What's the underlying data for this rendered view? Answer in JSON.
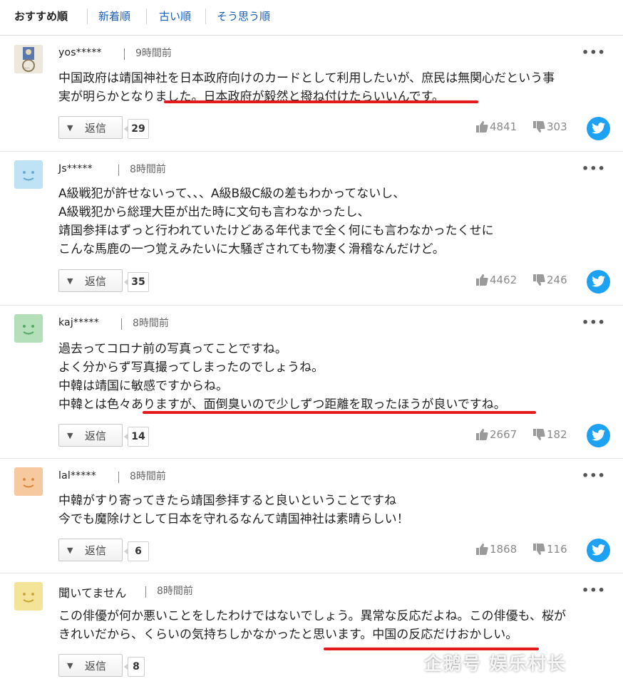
{
  "sort_tabs": [
    "おすすめ順",
    "新着順",
    "古い順",
    "そう思う順"
  ],
  "reply_label": "返信",
  "comments": [
    {
      "username": "yos*****",
      "time": "9時間前",
      "lines": [
        "中国政府は靖国神社を日本政府向けのカードとして利用したいが、庶民は無関心だという事",
        "実が明らかとなりました。日本政府が毅然と撥ね付けたらいいんです。"
      ],
      "reply_count": "29",
      "likes": "4841",
      "dislikes": "303"
    },
    {
      "username": "Js*****",
      "time": "8時間前",
      "lines": [
        "A級戦犯が許せないって、、、A級B級C級の差もわかってないし、",
        "A級戦犯から総理大臣が出た時に文句も言わなかったし、",
        "靖国参拝はずっと行われていたけどある年代まで全く何にも言わなかったくせに",
        "こんな馬鹿の一つ覚えみたいに大騒ぎされても物凄く滑稽なんだけど。"
      ],
      "reply_count": "35",
      "likes": "4462",
      "dislikes": "246"
    },
    {
      "username": "kaj*****",
      "time": "8時間前",
      "lines": [
        "過去ってコロナ前の写真ってことですね。",
        "よく分からず写真撮ってしまったのでしょうね。",
        "中韓は靖国に敏感ですからね。",
        "中韓とは色々ありますが、面倒臭いので少しずつ距離を取ったほうが良いですね。"
      ],
      "reply_count": "14",
      "likes": "2667",
      "dislikes": "182"
    },
    {
      "username": "lal*****",
      "time": "8時間前",
      "lines": [
        "中韓がすり寄ってきたら靖国参拝すると良いということですね",
        "今でも魔除けとして日本を守れるなんて靖国神社は素晴らしい！"
      ],
      "reply_count": "6",
      "likes": "1868",
      "dislikes": "116"
    },
    {
      "username": "聞いてません",
      "time": "8時間前",
      "lines": [
        "この俳優が何か悪いことをしたわけではないでしょう。異常な反応だよね。この俳優も、桜が",
        "きれいだから、くらいの気持ちしかなかったと思います。中国の反応だけおかしい。"
      ],
      "reply_count": "8"
    }
  ],
  "watermark": "企鹅号 娱乐村长",
  "colors": {
    "tab_link": "#1a5fb4",
    "underline": "#e3191b",
    "twitter": "#1da1f2",
    "avatar_blue": "#bde3f5",
    "avatar_green": "#b3dfb9",
    "avatar_orange": "#f6c99e",
    "avatar_yellow": "#f4e49a"
  },
  "icons": [
    "chevron-down-icon",
    "thumbs-up-icon",
    "thumbs-down-icon",
    "twitter-icon",
    "more-icon",
    "smiley-avatar-icon"
  ]
}
